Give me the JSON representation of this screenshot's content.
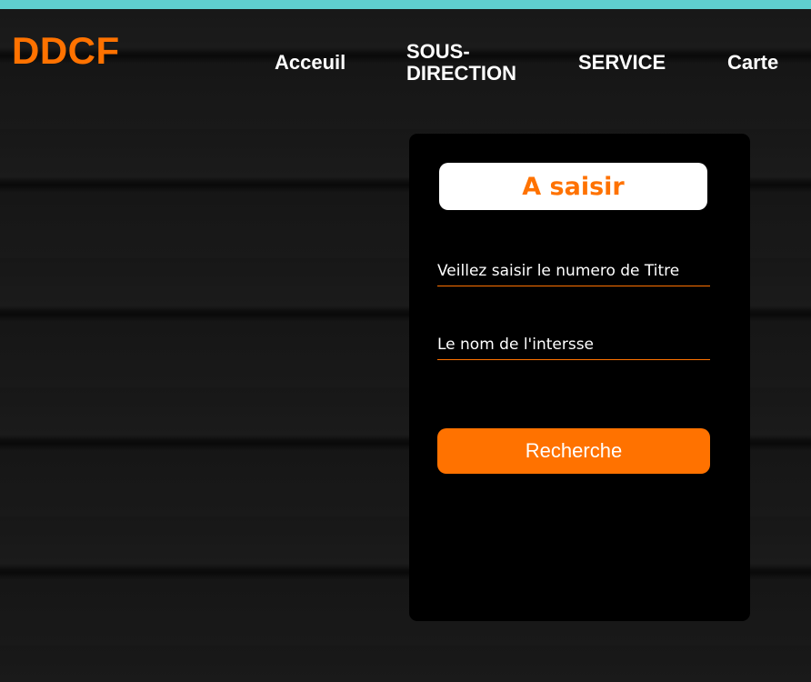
{
  "header": {
    "logo": "DDCF",
    "nav": {
      "acceuil": "Acceuil",
      "sous_direction_line1": "SOUS-",
      "sous_direction_line2": "DIRECTION",
      "service": "SERVICE",
      "carte": "Carte"
    }
  },
  "form": {
    "title": "A saisir",
    "titre_field": {
      "placeholder": "Veillez saisir le numero de Titre",
      "value": ""
    },
    "nom_field": {
      "placeholder": "Le nom de l'intersse",
      "value": ""
    },
    "submit_label": "Recherche"
  },
  "colors": {
    "accent": "#ff7200",
    "top_strip": "#5fcfcf",
    "panel": "#000000",
    "background": "#171717"
  }
}
